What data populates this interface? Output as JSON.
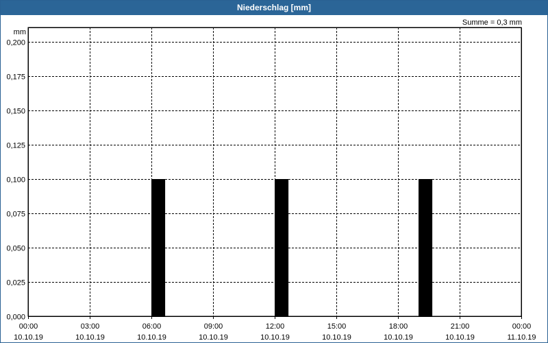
{
  "window": {
    "title": "Niederschlag [mm]"
  },
  "summary": "Summe = 0,3 mm",
  "chart_data": {
    "type": "bar",
    "title": "Niederschlag [mm]",
    "ylabel": "mm",
    "ylim": [
      0,
      0.2
    ],
    "yticks": [
      {
        "value": 0.0,
        "label": "0,000"
      },
      {
        "value": 0.025,
        "label": "0,025"
      },
      {
        "value": 0.05,
        "label": "0,050"
      },
      {
        "value": 0.075,
        "label": "0,075"
      },
      {
        "value": 0.1,
        "label": "0,100"
      },
      {
        "value": 0.125,
        "label": "0,125"
      },
      {
        "value": 0.15,
        "label": "0,150"
      },
      {
        "value": 0.175,
        "label": "0,175"
      },
      {
        "value": 0.2,
        "label": "0,200"
      }
    ],
    "xlim_hours": [
      0,
      24
    ],
    "xticks": [
      {
        "hour": 0,
        "time": "00:00",
        "date": "10.10.19"
      },
      {
        "hour": 3,
        "time": "03:00",
        "date": "10.10.19"
      },
      {
        "hour": 6,
        "time": "06:00",
        "date": "10.10.19"
      },
      {
        "hour": 9,
        "time": "09:00",
        "date": "10.10.19"
      },
      {
        "hour": 12,
        "time": "12:00",
        "date": "10.10.19"
      },
      {
        "hour": 15,
        "time": "15:00",
        "date": "10.10.19"
      },
      {
        "hour": 18,
        "time": "18:00",
        "date": "10.10.19"
      },
      {
        "hour": 21,
        "time": "21:00",
        "date": "10.10.19"
      },
      {
        "hour": 24,
        "time": "00:00",
        "date": "11.10.19"
      }
    ],
    "bars": [
      {
        "start_hour": 6.0,
        "end_hour": 6.67,
        "value": 0.1
      },
      {
        "start_hour": 12.0,
        "end_hour": 12.67,
        "value": 0.1
      },
      {
        "start_hour": 19.0,
        "end_hour": 19.67,
        "value": 0.1
      }
    ],
    "grid": true,
    "colors": {
      "bar": "#000000",
      "grid": "#000000",
      "title_bg": "#2b6597"
    }
  }
}
